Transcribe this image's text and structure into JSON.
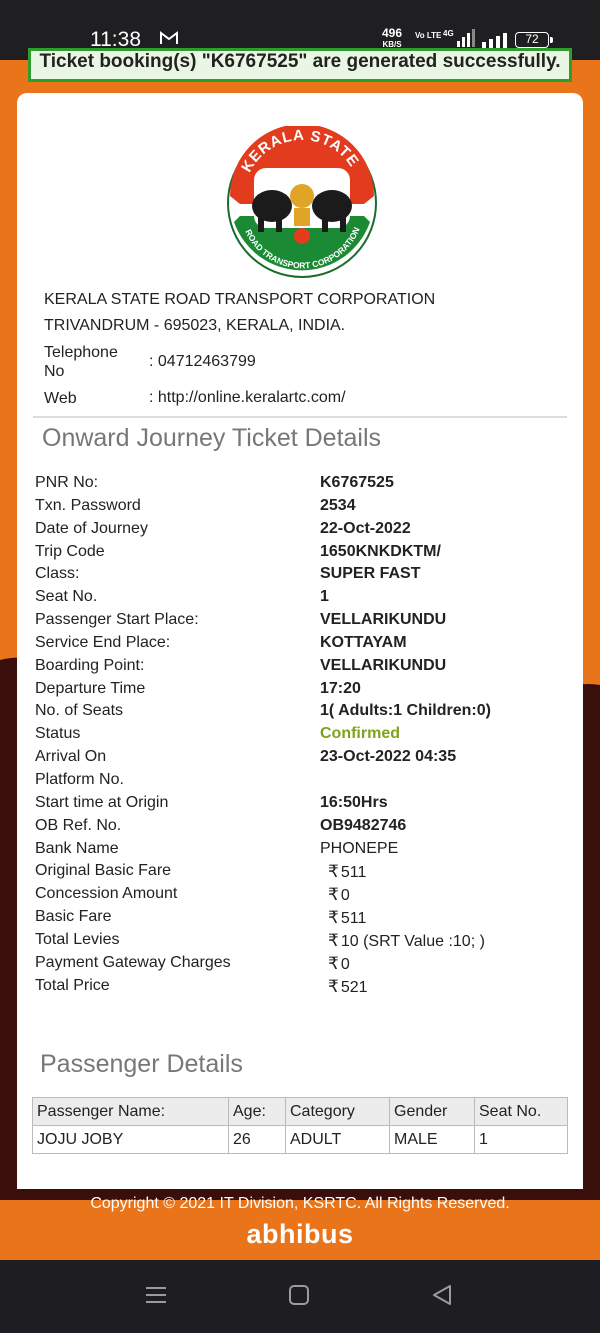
{
  "status_bar": {
    "time": "11:38",
    "speed_value": "496",
    "speed_unit": "KB/S",
    "volte": "Vo LTE",
    "battery": "72"
  },
  "banner_text": "Ticket booking(s) \"K6767525\" are generated successfully.",
  "org": {
    "name": "KERALA STATE ROAD TRANSPORT CORPORATION",
    "address": "TRIVANDRUM - 695023, KERALA, INDIA.",
    "telephone_label_line1": "Telephone",
    "telephone_label_line2": "No",
    "telephone_value": ": 04712463799",
    "web_label": "Web",
    "web_value": ": http://online.keralartc.com/",
    "logo_top_text": "KERALA STATE",
    "logo_bottom_text": "ROAD TRANSPORT CORPORATION"
  },
  "ticket": {
    "heading": "Onward Journey Ticket Details",
    "rows": [
      {
        "label": "PNR No:",
        "value": "K6767525"
      },
      {
        "label": "Txn. Password",
        "value": "2534"
      },
      {
        "label": "Date of Journey",
        "value": "22-Oct-2022"
      },
      {
        "label": "Trip Code",
        "value": "1650KNKDKTM/"
      },
      {
        "label": "Class:",
        "value": "SUPER FAST"
      },
      {
        "label": "Seat No.",
        "value": "1"
      },
      {
        "label": "Passenger Start Place:",
        "value": "VELLARIKUNDU"
      },
      {
        "label": "Service End Place:",
        "value": "KOTTAYAM"
      },
      {
        "label": "Boarding Point:",
        "value": "VELLARIKUNDU"
      },
      {
        "label": "Departure Time",
        "value": "17:20"
      },
      {
        "label": "No. of Seats",
        "value": "1( Adults:1  Children:0)"
      },
      {
        "label": "Status",
        "value": "Confirmed"
      },
      {
        "label": "Arrival On",
        "value": "23-Oct-2022 04:35"
      },
      {
        "label": "Platform No.",
        "value": ""
      },
      {
        "label": "Start time at Origin",
        "value": "16:50Hrs"
      },
      {
        "label": "OB Ref. No.",
        "value": "OB9482746"
      },
      {
        "label": "Bank Name",
        "value": "PHONEPE"
      },
      {
        "label": "Original Basic Fare",
        "value": "511"
      },
      {
        "label": "Concession Amount",
        "value": "0"
      },
      {
        "label": "Basic Fare",
        "value": "511"
      },
      {
        "label": "Total Levies",
        "value": "10  (SRT Value :10; )"
      },
      {
        "label": "Payment Gateway Charges",
        "value": "0"
      },
      {
        "label": "Total Price",
        "value": "521"
      }
    ],
    "currency_symbol": "₹",
    "status_color": "#7ea31b"
  },
  "passengers": {
    "heading": "Passenger Details",
    "columns": [
      "Passenger Name:",
      "Age:",
      "Category",
      "Gender",
      "Seat No."
    ],
    "rows": [
      [
        "JOJU JOBY",
        "26",
        "ADULT",
        "MALE",
        "1"
      ]
    ]
  },
  "footer": {
    "copyright": "Copyright © 2021 IT Division, KSRTC. All Rights Reserved.",
    "brand": "abhibus"
  },
  "nav": {
    "icons": [
      "menu-icon",
      "home-square-icon",
      "back-triangle-icon"
    ]
  },
  "colors": {
    "background": "#e9741a",
    "silhouette": "#3a0e0a",
    "banner_border": "#2e9d2e"
  }
}
